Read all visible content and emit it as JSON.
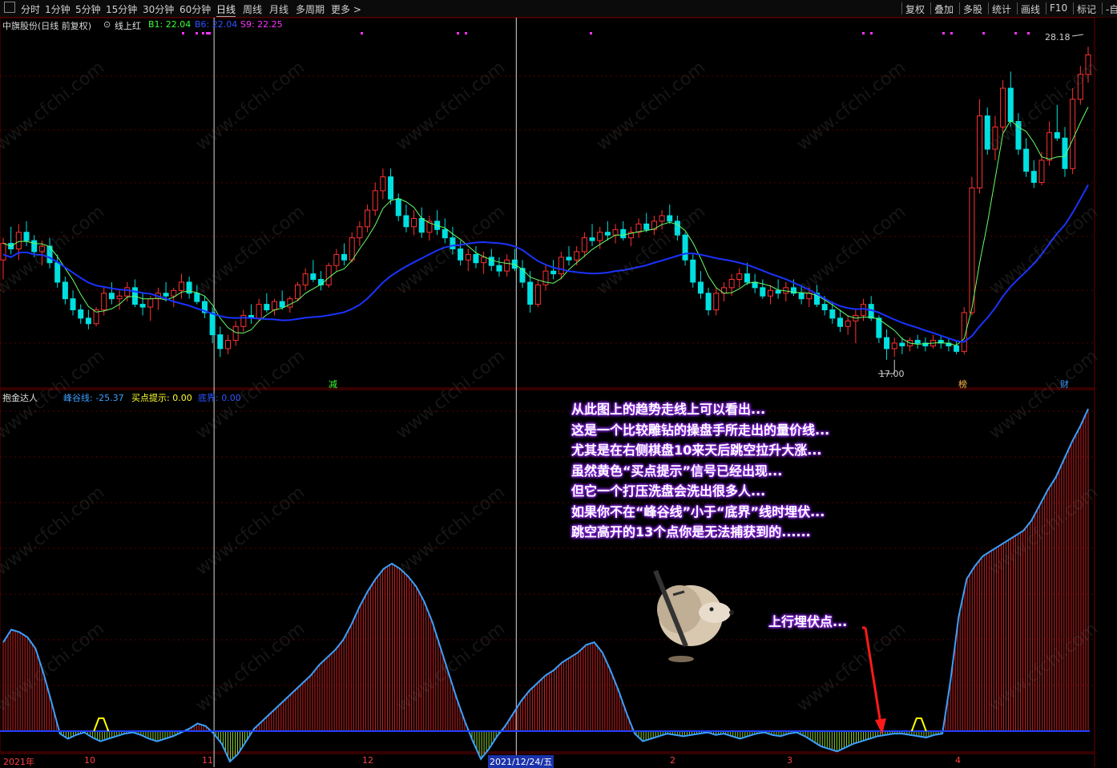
{
  "toolbar": {
    "left": [
      "分时",
      "1分钟",
      "5分钟",
      "15分钟",
      "30分钟",
      "60分钟",
      "日线",
      "周线",
      "月线",
      "多周期",
      "更多 >"
    ],
    "active": "日线",
    "right": [
      "复权",
      "叠加",
      "多股",
      "统计",
      "画线",
      "F10",
      "标记",
      "-自"
    ]
  },
  "main_header": {
    "stock": "中旗股份(日线 前复权)",
    "indicator": "线上红",
    "b1": "B1: 22.04",
    "b6": "B6: 22.04",
    "s9": "S9: 22.25"
  },
  "sub_header": {
    "name": "抱金达人",
    "peak": "峰谷线: -25.37",
    "buy": "买点提示: 0.00",
    "bottom": "底界: 0.00"
  },
  "price_labels": {
    "high": "28.18",
    "low": "17.00"
  },
  "markers": {
    "a": "减",
    "b": "榜",
    "c": "财"
  },
  "x_axis": [
    "2021年",
    "10",
    "11",
    "12",
    "2021/12/24/五",
    "2",
    "3",
    "4"
  ],
  "annotation": [
    "从此图上的趋势走线上可以看出...",
    "这是一个比较雕钻的操盘手所走出的量价线...",
    "尤其是在右侧棋盘10来天后跳空拉升大涨...",
    "虽然黄色“买点提示”信号已经出现...",
    "但它一个打压洗盘会洗出很多人...",
    "如果你不在“峰谷线”小于“底界”线时埋伏...",
    "跳空高开的13个点你是无法捕获到的......"
  ],
  "annotation2": "上行埋伏点...",
  "watermark": "www.cfchi.com",
  "colors": {
    "up": "#ff3232",
    "down": "#00e0e0",
    "ma_fast": "#66ff66",
    "ma_slow": "#1a33ff",
    "peak_line": "#3aa0ff",
    "bottom_line": "#2040ff",
    "buy_signal": "#ffff00"
  },
  "chart_data": {
    "type": "candlestick",
    "ylim": [
      16.5,
      29.0
    ],
    "price_high_label": 28.18,
    "price_low_label": 17.0,
    "candles": [
      [
        20.6,
        21.4,
        19.9,
        21.2
      ],
      [
        21.2,
        21.8,
        20.8,
        21.0
      ],
      [
        21.0,
        21.9,
        20.6,
        21.6
      ],
      [
        21.6,
        22.0,
        21.1,
        21.3
      ],
      [
        21.3,
        21.5,
        20.7,
        20.9
      ],
      [
        20.9,
        21.3,
        20.4,
        21.1
      ],
      [
        21.1,
        21.4,
        20.3,
        20.5
      ],
      [
        20.5,
        20.8,
        19.6,
        19.8
      ],
      [
        19.8,
        20.0,
        19.0,
        19.2
      ],
      [
        19.2,
        19.5,
        18.6,
        18.8
      ],
      [
        18.8,
        19.0,
        18.3,
        18.5
      ],
      [
        18.5,
        18.8,
        18.1,
        18.3
      ],
      [
        18.3,
        18.9,
        18.2,
        18.8
      ],
      [
        18.8,
        19.6,
        18.6,
        19.4
      ],
      [
        19.4,
        19.8,
        19.0,
        19.2
      ],
      [
        19.2,
        19.5,
        18.8,
        19.3
      ],
      [
        19.3,
        19.8,
        19.1,
        19.6
      ],
      [
        19.6,
        19.9,
        18.9,
        19.0
      ],
      [
        19.0,
        19.4,
        18.6,
        18.9
      ],
      [
        18.9,
        19.3,
        18.4,
        19.2
      ],
      [
        19.2,
        19.6,
        18.8,
        19.4
      ],
      [
        19.4,
        19.8,
        19.1,
        19.3
      ],
      [
        19.3,
        19.6,
        18.9,
        19.5
      ],
      [
        19.5,
        20.1,
        19.2,
        19.8
      ],
      [
        19.8,
        20.0,
        19.2,
        19.4
      ],
      [
        19.4,
        19.7,
        19.0,
        19.1
      ],
      [
        19.1,
        19.3,
        18.5,
        18.7
      ],
      [
        18.7,
        18.9,
        17.6,
        17.9
      ],
      [
        17.9,
        18.2,
        17.1,
        17.4
      ],
      [
        17.4,
        17.9,
        17.2,
        17.7
      ],
      [
        17.7,
        18.4,
        17.5,
        18.2
      ],
      [
        18.2,
        18.8,
        18.0,
        18.6
      ],
      [
        18.6,
        19.0,
        18.3,
        18.5
      ],
      [
        18.5,
        19.2,
        18.4,
        19.0
      ],
      [
        19.0,
        19.4,
        18.7,
        18.8
      ],
      [
        18.8,
        19.2,
        18.6,
        19.1
      ],
      [
        19.1,
        19.5,
        18.8,
        18.9
      ],
      [
        18.9,
        19.3,
        18.7,
        19.2
      ],
      [
        19.2,
        19.8,
        19.1,
        19.7
      ],
      [
        19.7,
        20.3,
        19.5,
        20.1
      ],
      [
        20.1,
        20.6,
        19.8,
        19.9
      ],
      [
        19.9,
        20.2,
        19.5,
        19.7
      ],
      [
        19.7,
        20.5,
        19.6,
        20.4
      ],
      [
        20.4,
        21.0,
        20.2,
        20.8
      ],
      [
        20.8,
        21.2,
        20.4,
        20.6
      ],
      [
        20.6,
        21.6,
        20.5,
        21.4
      ],
      [
        21.4,
        22.0,
        21.1,
        21.8
      ],
      [
        21.8,
        22.6,
        21.6,
        22.4
      ],
      [
        22.4,
        23.4,
        22.2,
        23.1
      ],
      [
        23.1,
        23.9,
        22.8,
        23.6
      ],
      [
        23.6,
        23.9,
        22.6,
        22.8
      ],
      [
        22.8,
        23.0,
        22.0,
        22.2
      ],
      [
        22.2,
        22.6,
        21.6,
        21.8
      ],
      [
        21.8,
        22.4,
        21.5,
        22.1
      ],
      [
        22.1,
        22.5,
        21.4,
        21.6
      ],
      [
        21.6,
        22.2,
        21.3,
        22.0
      ],
      [
        22.0,
        22.4,
        21.5,
        21.7
      ],
      [
        21.7,
        22.1,
        21.2,
        21.4
      ],
      [
        21.4,
        21.8,
        20.8,
        21.0
      ],
      [
        21.0,
        21.3,
        20.4,
        20.6
      ],
      [
        20.6,
        21.0,
        20.2,
        20.8
      ],
      [
        20.8,
        21.1,
        20.3,
        20.5
      ],
      [
        20.5,
        20.9,
        20.1,
        20.7
      ],
      [
        20.7,
        21.0,
        20.2,
        20.4
      ],
      [
        20.4,
        20.7,
        20.0,
        20.2
      ],
      [
        20.2,
        20.8,
        20.0,
        20.6
      ],
      [
        20.6,
        21.0,
        20.2,
        20.3
      ],
      [
        20.3,
        20.6,
        19.6,
        19.8
      ],
      [
        19.8,
        20.2,
        18.7,
        19.0
      ],
      [
        19.0,
        19.9,
        18.9,
        19.7
      ],
      [
        19.7,
        20.4,
        19.5,
        20.2
      ],
      [
        20.2,
        20.6,
        19.9,
        20.1
      ],
      [
        20.1,
        20.9,
        19.9,
        20.7
      ],
      [
        20.7,
        21.1,
        20.4,
        20.6
      ],
      [
        20.6,
        21.1,
        20.4,
        20.9
      ],
      [
        20.9,
        21.6,
        20.7,
        21.4
      ],
      [
        21.4,
        21.9,
        21.1,
        21.3
      ],
      [
        21.3,
        21.8,
        21.0,
        21.6
      ],
      [
        21.6,
        22.0,
        21.3,
        21.5
      ],
      [
        21.5,
        21.9,
        21.2,
        21.7
      ],
      [
        21.7,
        22.0,
        21.3,
        21.4
      ],
      [
        21.4,
        21.8,
        21.1,
        21.6
      ],
      [
        21.6,
        22.1,
        21.4,
        21.9
      ],
      [
        21.9,
        22.3,
        21.6,
        21.7
      ],
      [
        21.7,
        22.2,
        21.5,
        22.0
      ],
      [
        22.0,
        22.4,
        21.7,
        22.2
      ],
      [
        22.2,
        22.6,
        21.9,
        22.0
      ],
      [
        22.0,
        22.2,
        21.3,
        21.5
      ],
      [
        21.5,
        21.6,
        20.4,
        20.6
      ],
      [
        20.6,
        20.8,
        19.6,
        19.8
      ],
      [
        19.8,
        20.2,
        19.2,
        19.4
      ],
      [
        19.4,
        19.6,
        18.6,
        18.8
      ],
      [
        18.8,
        19.6,
        18.6,
        19.4
      ],
      [
        19.4,
        19.8,
        19.1,
        19.6
      ],
      [
        19.6,
        20.1,
        19.3,
        19.9
      ],
      [
        19.9,
        20.3,
        19.6,
        20.1
      ],
      [
        20.1,
        20.5,
        19.7,
        19.8
      ],
      [
        19.8,
        20.1,
        19.4,
        19.6
      ],
      [
        19.6,
        19.9,
        19.2,
        19.3
      ],
      [
        19.3,
        19.7,
        19.0,
        19.5
      ],
      [
        19.5,
        19.9,
        19.2,
        19.4
      ],
      [
        19.4,
        19.8,
        19.1,
        19.6
      ],
      [
        19.6,
        19.9,
        19.3,
        19.4
      ],
      [
        19.4,
        19.7,
        19.0,
        19.2
      ],
      [
        19.2,
        19.6,
        18.9,
        19.4
      ],
      [
        19.4,
        19.7,
        18.9,
        19.0
      ],
      [
        19.0,
        19.3,
        18.6,
        18.8
      ],
      [
        18.8,
        19.1,
        18.3,
        18.5
      ],
      [
        18.5,
        18.8,
        18.0,
        18.2
      ],
      [
        18.2,
        18.6,
        17.9,
        18.4
      ],
      [
        18.4,
        18.8,
        17.6,
        18.6
      ],
      [
        18.6,
        19.2,
        18.4,
        19.0
      ],
      [
        19.0,
        19.3,
        18.4,
        18.5
      ],
      [
        18.5,
        18.6,
        17.6,
        17.8
      ],
      [
        17.8,
        18.1,
        17.0,
        17.4
      ],
      [
        17.4,
        17.8,
        17.1,
        17.6
      ],
      [
        17.6,
        17.8,
        17.2,
        17.5
      ],
      [
        17.5,
        17.8,
        17.3,
        17.7
      ],
      [
        17.7,
        17.9,
        17.4,
        17.6
      ],
      [
        17.6,
        17.8,
        17.3,
        17.5
      ],
      [
        17.5,
        17.9,
        17.4,
        17.7
      ],
      [
        17.7,
        17.9,
        17.4,
        17.6
      ],
      [
        17.6,
        17.8,
        17.3,
        17.5
      ],
      [
        17.5,
        17.7,
        17.2,
        17.3
      ],
      [
        17.3,
        18.9,
        17.2,
        18.7
      ],
      [
        18.7,
        23.6,
        18.6,
        23.2
      ],
      [
        23.2,
        26.4,
        23.0,
        25.8
      ],
      [
        25.8,
        26.1,
        24.4,
        24.6
      ],
      [
        24.6,
        25.8,
        24.2,
        25.4
      ],
      [
        25.4,
        27.1,
        25.2,
        26.8
      ],
      [
        26.8,
        27.4,
        25.4,
        25.6
      ],
      [
        25.6,
        25.9,
        24.4,
        24.6
      ],
      [
        24.6,
        25.0,
        23.6,
        23.8
      ],
      [
        23.8,
        24.2,
        23.2,
        23.4
      ],
      [
        23.4,
        24.5,
        23.3,
        24.2
      ],
      [
        24.2,
        25.6,
        24.0,
        25.2
      ],
      [
        25.2,
        26.2,
        24.9,
        25.0
      ],
      [
        25.0,
        25.4,
        23.6,
        23.9
      ],
      [
        23.9,
        26.8,
        23.7,
        26.4
      ],
      [
        26.4,
        27.6,
        26.2,
        27.3
      ],
      [
        27.3,
        28.3,
        27.0,
        28.0
      ]
    ],
    "peak_valley_range": [
      -30,
      120
    ],
    "peak_valley": [
      70,
      80,
      78,
      74,
      65,
      45,
      22,
      -2,
      -6,
      -3,
      -1,
      -5,
      -8,
      -6,
      -4,
      -2,
      -1,
      -3,
      -6,
      -8,
      -6,
      -4,
      -1,
      2,
      6,
      4,
      -2,
      -10,
      -24,
      -18,
      -8,
      2,
      8,
      14,
      20,
      26,
      32,
      38,
      44,
      52,
      58,
      64,
      72,
      84,
      98,
      110,
      120,
      128,
      132,
      128,
      122,
      114,
      102,
      86,
      66,
      46,
      26,
      8,
      -8,
      -22,
      -14,
      -4,
      4,
      14,
      24,
      32,
      38,
      44,
      48,
      54,
      58,
      62,
      68,
      70,
      62,
      48,
      32,
      14,
      -2,
      -8,
      -6,
      -4,
      -2,
      -3,
      -4,
      -3,
      -2,
      -1,
      -3,
      -2,
      -4,
      -6,
      -4,
      -2,
      -1,
      -3,
      -4,
      -2,
      -1,
      -4,
      -8,
      -12,
      -14,
      -16,
      -13,
      -10,
      -8,
      -6,
      -4,
      -3,
      -2,
      -2,
      -3,
      -4,
      -5,
      -3,
      -2,
      40,
      90,
      120,
      130,
      138,
      142,
      146,
      150,
      154,
      158,
      166,
      178,
      190,
      200,
      214,
      228,
      240,
      254
    ],
    "bottom_line": 0,
    "buy_signals_at": [
      12,
      113
    ]
  }
}
